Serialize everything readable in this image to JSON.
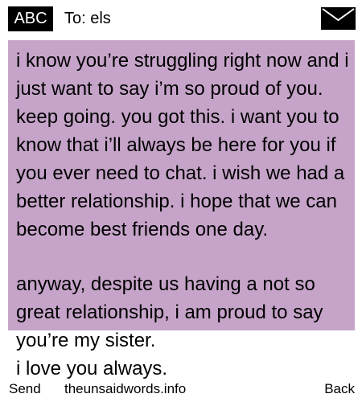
{
  "header": {
    "badge": "ABC",
    "to_line": "To: els",
    "envelope_icon": "envelope-icon"
  },
  "message": {
    "body": "i know you’re struggling right now and i just want to say i’m so proud of you. keep going. you got this. i want you to know that i’ll always be here for you if you ever need to chat. i wish we had a better relationship. i hope that we can become best friends one day.",
    "overflow": "anyway, despite us having a not so great relationship, i am proud to say you’re my sister.\ni love you always.",
    "panel_color": "#c6a4c9"
  },
  "footer": {
    "send_label": "Send",
    "site_label": "theunsaidwords.info",
    "back_label": "Back"
  }
}
